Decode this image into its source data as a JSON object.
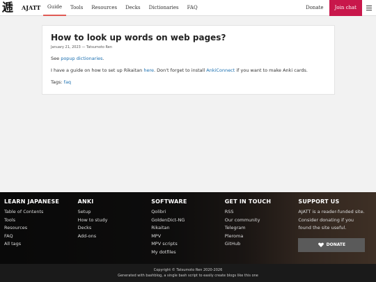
{
  "nav": {
    "logo_glyph": "逓",
    "brand": "AJATT",
    "items": [
      "Guide",
      "Tools",
      "Resources",
      "Decks",
      "Dictionaries",
      "FAQ"
    ],
    "donate": "Donate",
    "join_chat": "Join chat"
  },
  "post": {
    "title": "How to look up words on web pages?",
    "meta": "January 21, 2023 — Tatsumoto Ren",
    "p1_prefix": "See ",
    "p1_link": "popup dictionaries",
    "p1_suffix": ".",
    "p2_prefix": "I have a guide on how to set up Rikaitan ",
    "p2_link1": "here",
    "p2_mid": ". Don't forget to install ",
    "p2_link2": "AnkiConnect",
    "p2_suffix": " if you want to make Anki cards.",
    "tags_label": "Tags: ",
    "tag": "faq"
  },
  "footer": {
    "cols": [
      {
        "title": "LEARN JAPANESE",
        "links": [
          "Table of Contents",
          "Tools",
          "Resources",
          "FAQ",
          "All tags"
        ]
      },
      {
        "title": "ANKI",
        "links": [
          "Setup",
          "How to study",
          "Decks",
          "Add-ons"
        ]
      },
      {
        "title": "SOFTWARE",
        "links": [
          "Qolibri",
          "GoldenDict-NG",
          "Rikaitan",
          "MPV",
          "MPV scripts",
          "My dotfiles"
        ]
      },
      {
        "title": "GET IN TOUCH",
        "links": [
          "RSS",
          "Our community",
          "Telegram",
          "Pleroma",
          "GitHub"
        ]
      }
    ],
    "support": {
      "title": "SUPPORT US",
      "text": "AJATT is a reader-funded site. Consider donating if you found the site useful.",
      "button": "DONATE"
    },
    "copyright": "Copyright © Tatsumoto Ren 2020-2026",
    "generated": "Generated with bashblog, a single bash script to easily create blogs like this one"
  },
  "colors": {
    "accent": "#c8174b",
    "link": "#1a6fb0",
    "active_underline": "#e05a54"
  }
}
